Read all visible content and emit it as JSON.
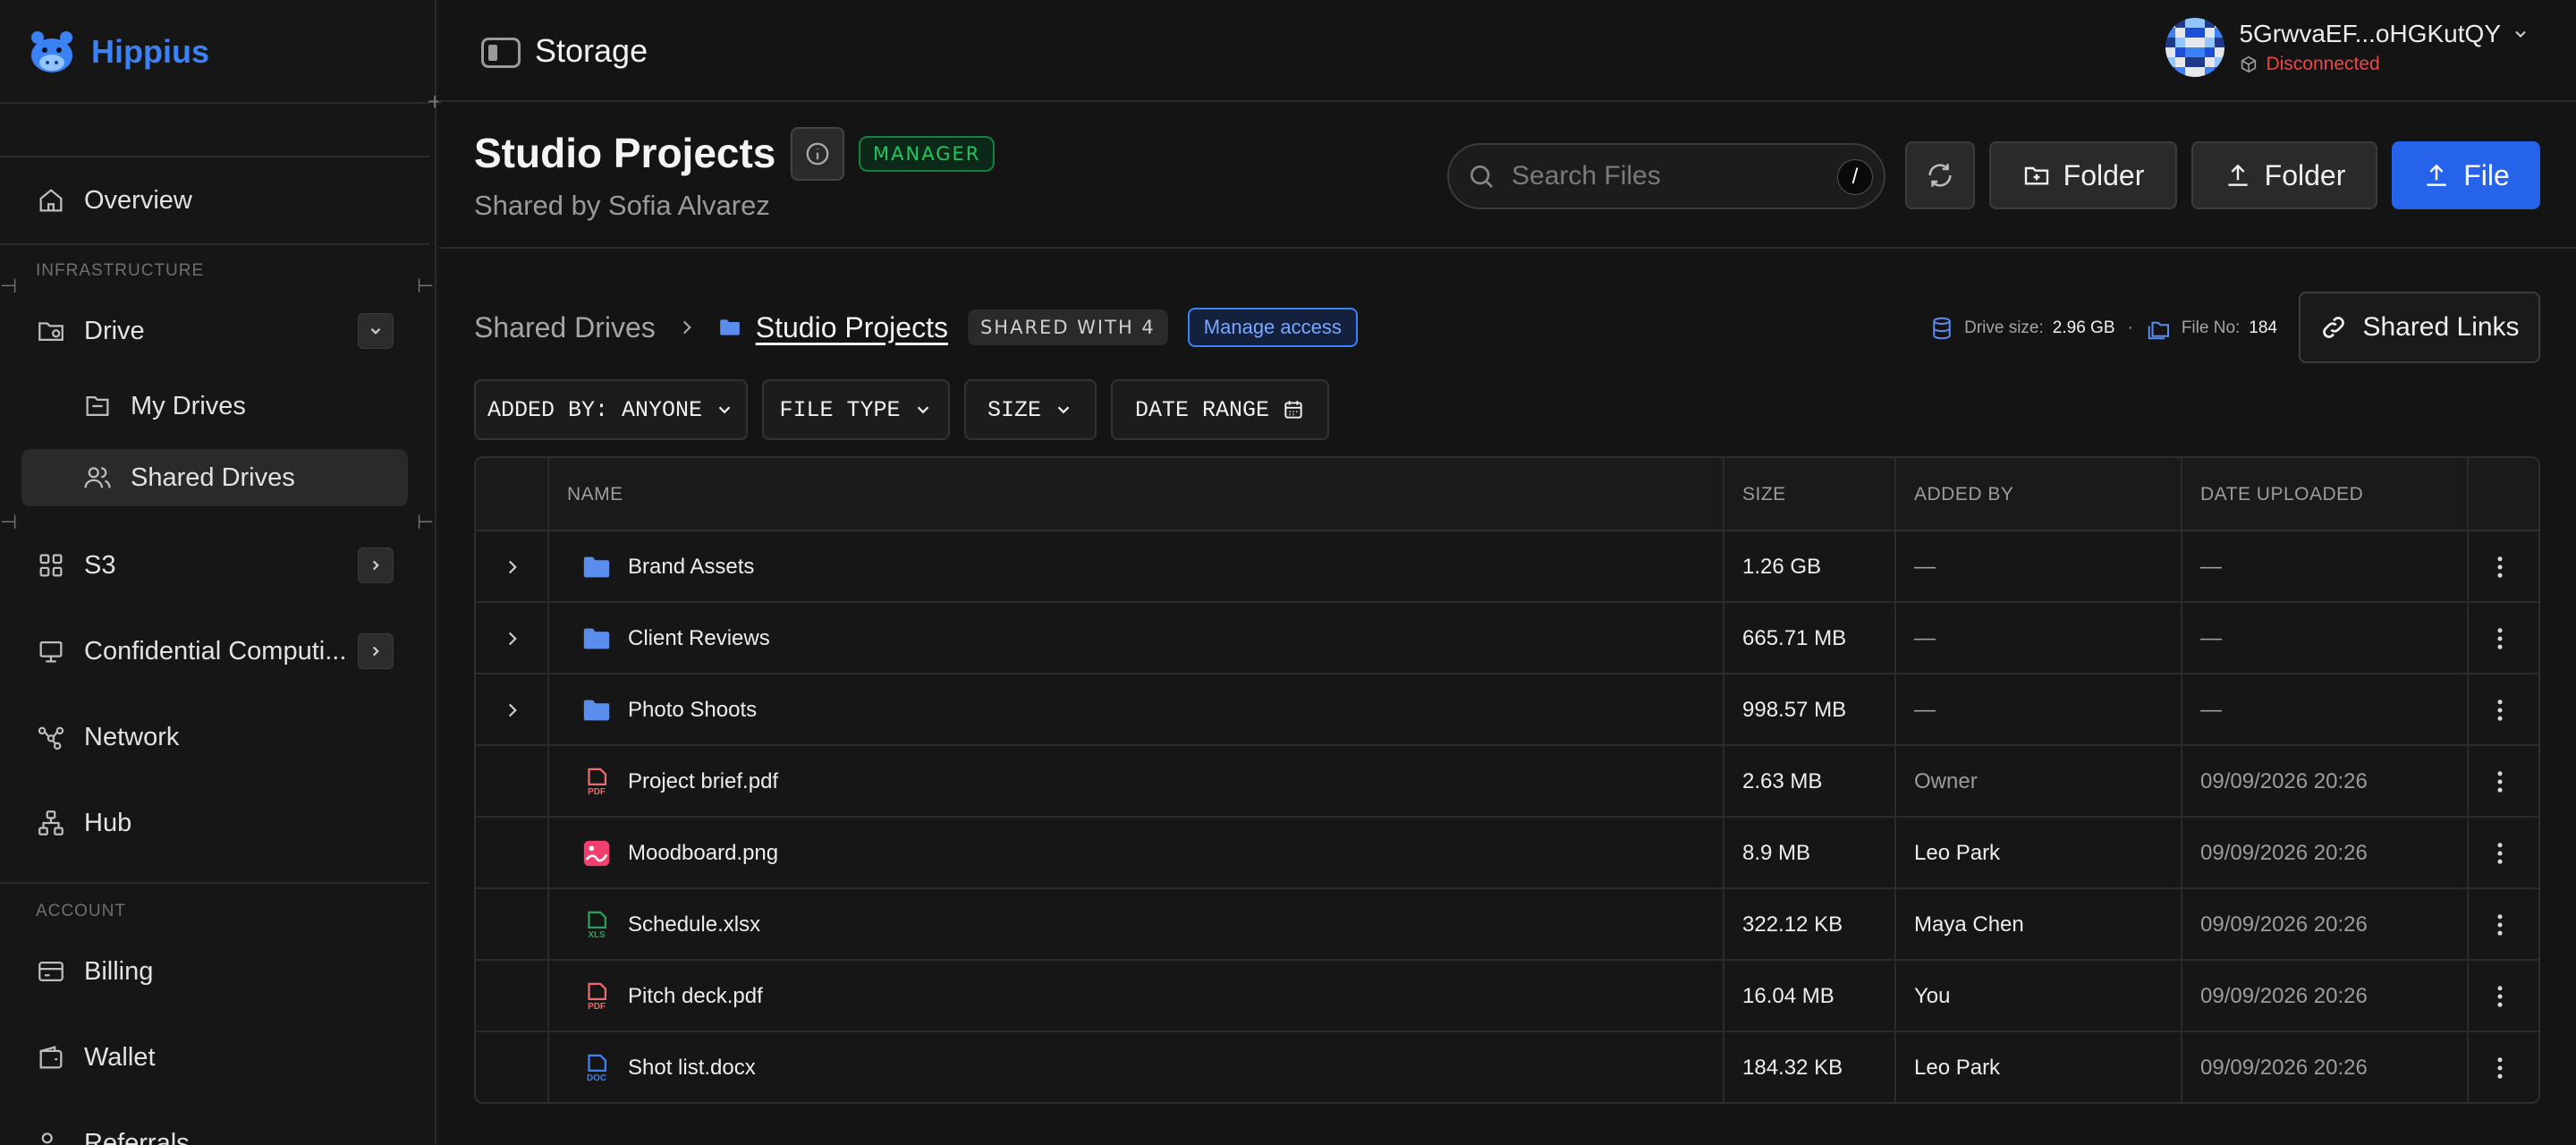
{
  "app": {
    "name": "Hippius"
  },
  "sidebar": {
    "items": [
      {
        "label": "Overview",
        "icon": "home-icon"
      },
      {
        "label": "Drive",
        "icon": "folder-icon"
      },
      {
        "label": "My Drives",
        "icon": "drive-icon"
      },
      {
        "label": "Shared Drives",
        "icon": "users-icon"
      },
      {
        "label": "S3",
        "icon": "grid-icon"
      },
      {
        "label": "Confidential Computi...",
        "icon": "monitor-icon"
      },
      {
        "label": "Network",
        "icon": "network-icon"
      },
      {
        "label": "Hub",
        "icon": "hub-icon"
      },
      {
        "label": "Billing",
        "icon": "card-icon"
      },
      {
        "label": "Wallet",
        "icon": "wallet-icon"
      },
      {
        "label": "Referrals",
        "icon": "referral-icon"
      }
    ],
    "sections": {
      "infrastructure": "INFRASTRUCTURE",
      "account": "ACCOUNT"
    }
  },
  "topbar": {
    "title": "Storage"
  },
  "user": {
    "address": "5GrwvaEF...oHGKutQY",
    "status": "Disconnected",
    "status_color": "#ef4444"
  },
  "header": {
    "title": "Studio Projects",
    "badge": "MANAGER",
    "subtitle": "Shared by Sofia Alvarez",
    "search_placeholder": "Search Files",
    "search_shortcut": "/",
    "new_folder_label": "Folder",
    "upload_folder_label": "Folder",
    "upload_file_label": "File"
  },
  "breadcrumb": {
    "root": "Shared Drives",
    "current": "Studio Projects",
    "shared_with": "SHARED WITH 4",
    "manage": "Manage access"
  },
  "drive_info": {
    "size_label": "Drive size:",
    "size_value": "2.96 GB",
    "files_label": "File No:",
    "files_value": "184"
  },
  "shared_links_label": "Shared Links",
  "filters": [
    "ADDED BY: ANYONE",
    "FILE TYPE",
    "SIZE",
    "DATE RANGE"
  ],
  "table": {
    "columns": [
      "NAME",
      "SIZE",
      "ADDED BY",
      "DATE UPLOADED"
    ],
    "rows": [
      {
        "name": "Brand Assets",
        "type": "folder",
        "size": "1.26 GB",
        "added_by": "—",
        "date": "—"
      },
      {
        "name": "Client Reviews",
        "type": "folder",
        "size": "665.71 MB",
        "added_by": "—",
        "date": "—"
      },
      {
        "name": "Photo Shoots",
        "type": "folder",
        "size": "998.57 MB",
        "added_by": "—",
        "date": "—"
      },
      {
        "name": "Project brief.pdf",
        "type": "pdf",
        "size": "2.63 MB",
        "added_by": "Owner",
        "date": "09/09/2026 20:26"
      },
      {
        "name": "Moodboard.png",
        "type": "image",
        "size": "8.9 MB",
        "added_by": "Leo Park",
        "date": "09/09/2026 20:26"
      },
      {
        "name": "Schedule.xlsx",
        "type": "xls",
        "size": "322.12 KB",
        "added_by": "Maya Chen",
        "date": "09/09/2026 20:26"
      },
      {
        "name": "Pitch deck.pdf",
        "type": "pdf",
        "size": "16.04 MB",
        "added_by": "You",
        "date": "09/09/2026 20:26"
      },
      {
        "name": "Shot list.docx",
        "type": "doc",
        "size": "184.32 KB",
        "added_by": "Leo Park",
        "date": "09/09/2026 20:26"
      }
    ]
  },
  "colors": {
    "accent": "#2563eb",
    "folder": "#5b8def",
    "manager": "#22c55e",
    "pdf": "#ef6b6b",
    "image": "#f43f6e",
    "xls": "#22a55a",
    "doc": "#3b82f6"
  }
}
